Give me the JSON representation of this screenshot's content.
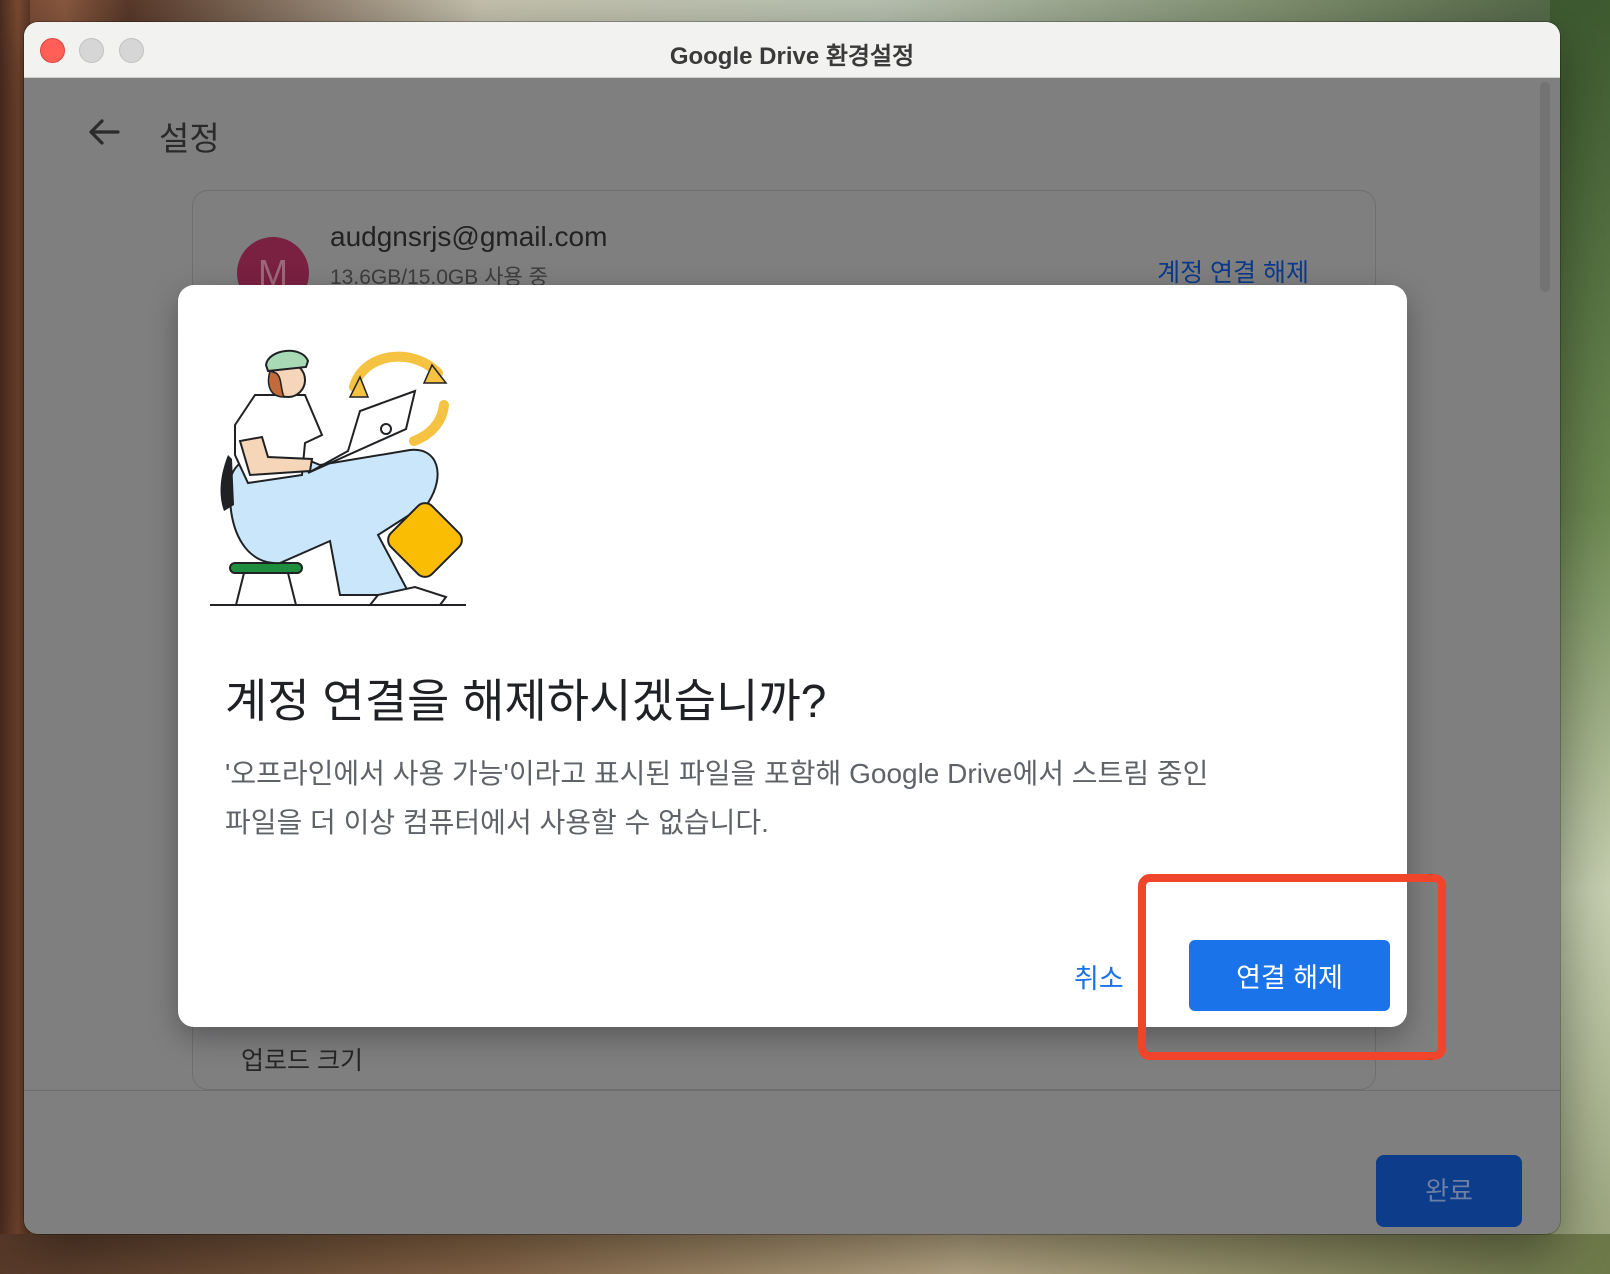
{
  "window": {
    "title": "Google Drive 환경설정"
  },
  "page": {
    "title": "설정"
  },
  "account": {
    "avatar_letter": "M",
    "email": "audgnsrjs@gmail.com",
    "usage": "13.6GB/15.0GB 사용 중",
    "disconnect_link": "계정 연결 해제"
  },
  "settings": {
    "upload_size_label": "업로드 크기"
  },
  "footer": {
    "done_label": "완료"
  },
  "dialog": {
    "title": "계정 연결을 해제하시겠습니까?",
    "body_line1": "'오프라인에서 사용 가능'이라고 표시된 파일을 포함해 Google Drive에서 스트림 중인",
    "body_line2": "파일을 더 이상 컴퓨터에서 사용할 수 없습니다.",
    "cancel_label": "취소",
    "confirm_label": "연결 해제"
  },
  "colors": {
    "accent": "#1a73e8",
    "highlight": "#f0452a",
    "close_button": "#ff5f57"
  },
  "icons": {
    "back": "arrow-left-icon",
    "illustration": "person-laptop-sync-illustration"
  }
}
